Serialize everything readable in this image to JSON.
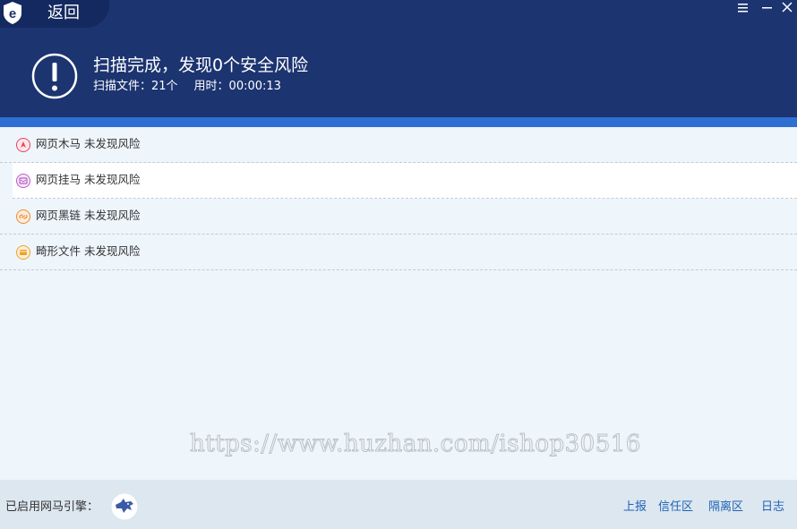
{
  "header": {
    "back_label": "返回",
    "title": "扫描完成，发现0个安全风险",
    "files_label": "扫描文件：21个",
    "time_label": "用时：00:00:13",
    "controls": [
      "menu-icon",
      "minimize-icon",
      "close-icon"
    ]
  },
  "results": [
    {
      "label": "网页木马 未发现风险",
      "icon": "trojan-icon",
      "color": "#e8445a"
    },
    {
      "label": "网页挂马 未发现风险",
      "icon": "hanging-horse-icon",
      "color": "#b95fc7"
    },
    {
      "label": "网页黑链 未发现风险",
      "icon": "black-link-icon",
      "color": "#f08a2d"
    },
    {
      "label": "畸形文件 未发现风险",
      "icon": "malformed-file-icon",
      "color": "#f2a024"
    }
  ],
  "watermark": "https://www.huzhan.com/ishop30516",
  "footer": {
    "engine_label": "已启用网马引擎：",
    "links": [
      "上报",
      "信任区",
      "隔离区",
      "日志"
    ]
  },
  "colors": {
    "header_bg": "#1c3470",
    "accent": "#2f6fd4",
    "link": "#1f63b5"
  }
}
